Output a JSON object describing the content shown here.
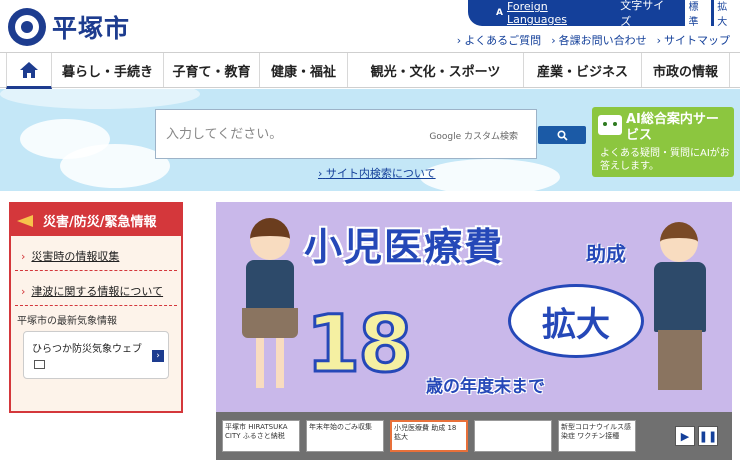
{
  "header": {
    "logo_text": "平塚市",
    "foreign_label": "Foreign Languages",
    "foreign_icon_text": "A",
    "font_size_label": "文字サイズ",
    "size_standard": "標準",
    "size_large": "拡大",
    "sublinks": [
      "よくあるご質問",
      "各課お問い合わせ",
      "サイトマップ"
    ]
  },
  "nav": {
    "items": [
      "暮らし・手続き",
      "子育て・教育",
      "健康・福祉",
      "観光・文化・スポーツ",
      "産業・ビジネス",
      "市政の情報"
    ]
  },
  "search": {
    "placeholder": "入力してください。",
    "brand": "Google カスタム検索",
    "help_link": "サイト内検索について"
  },
  "ai_banner": {
    "title": "AI総合案内サービス",
    "subtitle": "よくある疑問・質問にAIがお答えします。"
  },
  "disaster": {
    "title": "災害/防災/緊急情報",
    "links": [
      "災害時の情報収集",
      "津波に関する情報について"
    ],
    "weather_label": "平塚市の最新気象情報",
    "card_label": "ひらつか防災気象ウェブ"
  },
  "banner": {
    "title": "小児医療費",
    "title_suffix": "助成",
    "bubble_text": "拡大",
    "age_number": "18",
    "age_text": "歳の年度末まで"
  },
  "thumbnails": [
    "平塚市 HIRATSUKA CITY ふるさと納税",
    "年末年始のごみ収集",
    "小児医療費 助成 18 拡大",
    "",
    "",
    "新型コロナウイルス感染症 ワクチン接種"
  ],
  "colors": {
    "brand_blue": "#1d3c8f",
    "alert_red": "#d4373b",
    "ai_green": "#8cc63f"
  }
}
